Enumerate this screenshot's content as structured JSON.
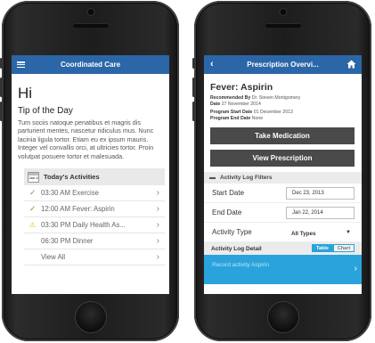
{
  "left": {
    "nav_title": "Coordinated Care",
    "greeting": "Hi",
    "tip_title": "Tip of the Day",
    "tip_body": "Tum sociis natoque penatibus et magris dis parturient mentes, nascetur ridiculus mus. Nunc lacinia ligula tortor. Etiam eu ex ipsum mauris. Integer vel convallis orci, at ultricies tortor. Proin volutpat posuere tortor et malesuada.",
    "calendar_icon_text": "Jan 4",
    "activities_title": "Today's Activities",
    "activities": [
      {
        "status": "done",
        "icon": "check-icon",
        "label": "03:30 AM Exercise"
      },
      {
        "status": "done",
        "icon": "check-icon",
        "label": "12:00 AM Fever: Aspirin"
      },
      {
        "status": "warning",
        "icon": "warning-icon",
        "label": "03:30 PM Daily Health As..."
      },
      {
        "status": "none",
        "icon": "",
        "label": "06:30 PM Dinner"
      }
    ],
    "view_all_label": "View All"
  },
  "right": {
    "nav_title": "Prescription Overvi...",
    "title": "Fever: Aspirin",
    "recommended_label": "Recommended By",
    "recommended_value": "Dr. Steven Montgomery",
    "date_label": "Date",
    "date_value": "27 November 2014",
    "program_start_label": "Program Start Date",
    "program_start_value": "01 December 2013",
    "program_end_label": "Program End Date",
    "program_end_value": "None",
    "take_medication_label": "Take Medication",
    "view_prescription_label": "View Prescription",
    "filters_title": "Activity Log Filters",
    "start_date_label": "Start Date",
    "start_date_value": "Dec 23, 2013",
    "end_date_label": "End Date",
    "end_date_value": "Jan 22, 2014",
    "activity_type_label": "Activity Type",
    "activity_type_value": "All Types",
    "log_detail_label": "Activity Log Detail",
    "segment_options": [
      "Table",
      "Chart"
    ],
    "selected_segment": "Table",
    "log_entry_label": "Record activity Aspirin"
  },
  "colors": {
    "nav_blue": "#2b67a8",
    "dark_button": "#4a4a4a",
    "accent_cyan": "#2aa3dc",
    "check_green": "#6aa535",
    "warning_yellow": "#e6b800"
  }
}
